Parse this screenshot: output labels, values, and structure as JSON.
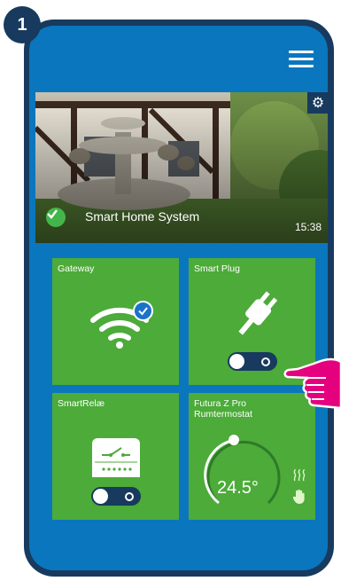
{
  "step": {
    "number": "1"
  },
  "colors": {
    "frame": "#173a5e",
    "screen": "#0a76be",
    "tile": "#4cab39",
    "accent": "#e5007e"
  },
  "header": {
    "menu_icon": "hamburger-menu-icon"
  },
  "hero": {
    "title": "Smart Home System",
    "time": "15:38",
    "settings_icon": "gear-icon",
    "status_icon": "check-circle-icon"
  },
  "tiles": [
    {
      "label": "Gateway",
      "icon": "wifi-icon",
      "badge_icon": "check-badge-icon"
    },
    {
      "label": "Smart Plug",
      "icon": "plug-icon"
    },
    {
      "label": "SmartRelæ",
      "icon": "relay-switch-icon"
    },
    {
      "label": "Futura Z Pro Rumtermostat",
      "temperature": "24.5°",
      "icon": "thermostat-dial-icon"
    }
  ],
  "pointer": {
    "icon": "pointing-hand-icon"
  }
}
